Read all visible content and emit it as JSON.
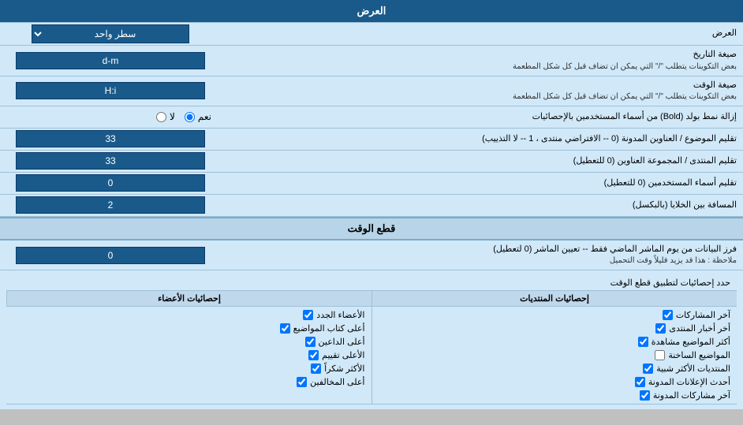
{
  "title": "العرض",
  "rows": [
    {
      "id": "display_mode",
      "label": "العرض",
      "input_type": "select",
      "value": "سطر واحد"
    },
    {
      "id": "date_format",
      "label": "صيغة التاريخ",
      "sub_label": "بعض التكوينات يتطلب \"/\" التي يمكن ان تضاف قبل كل شكل المطعمة",
      "input_type": "text",
      "value": "d-m"
    },
    {
      "id": "time_format",
      "label": "صيغة الوقت",
      "sub_label": "بعض التكوينات يتطلب \"/\" التي يمكن ان تضاف قبل كل شكل المطعمة",
      "input_type": "text",
      "value": "H:i"
    },
    {
      "id": "bold_remove",
      "label": "إزالة نمط بولد (Bold) من أسماء المستخدمين بالإحصائيات",
      "input_type": "radio",
      "options": [
        "نعم",
        "لا"
      ],
      "selected": "نعم"
    },
    {
      "id": "topic_limit",
      "label": "تقليم الموضوع / العناوين المدونة (0 -- الافتراضي منتدى ، 1 -- لا التذييب)",
      "input_type": "text",
      "value": "33"
    },
    {
      "id": "forum_limit",
      "label": "تقليم المنتدى / المجموعة العناوين (0 للتعطيل)",
      "input_type": "text",
      "value": "33"
    },
    {
      "id": "username_limit",
      "label": "تقليم أسماء المستخدمين (0 للتعطيل)",
      "input_type": "text",
      "value": "0"
    },
    {
      "id": "cell_spacing",
      "label": "المسافة بين الخلايا (بالبكسل)",
      "input_type": "text",
      "value": "2"
    }
  ],
  "cut_section": {
    "header": "قطع الوقت",
    "row": {
      "label": "فرز البيانات من يوم الماشر الماضي فقط -- تعيين الماشر (0 لتعطيل)",
      "sub_label": "ملاحظة : هذا قد يزيد قليلاً وقت التحميل",
      "value": "0"
    },
    "notice_label": "حدد إحصائيات لتطبيق قطع الوقت"
  },
  "checkboxes": {
    "header_left": "إحصائيات الأعضاء",
    "header_right": "إحصائيات المنتديات",
    "left_items": [
      "الأعضاء الجدد",
      "أعلى كتاب المواضيع",
      "أعلى الداعين",
      "الأعلى تقييم",
      "الأكثر شكراً",
      "أعلى المخالفين"
    ],
    "right_items": [
      "آخر المشاركات",
      "أخر أخبار المنتدى",
      "أكثر المواضيع مشاهدة",
      "المواضيع الساخنة",
      "المنتديات الأكثر شبية",
      "أحدث الإعلانات المدونة",
      "آخر مشاركات المدونة"
    ]
  }
}
